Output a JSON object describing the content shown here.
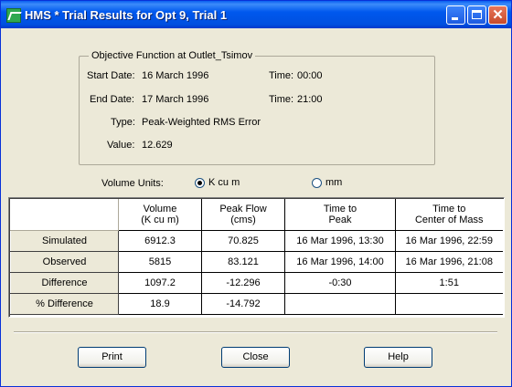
{
  "window": {
    "title": "HMS * Trial Results for Opt 9, Trial 1"
  },
  "objective": {
    "group_title": "Objective Function at Outlet_Tsimov",
    "start_date_label": "Start Date:",
    "start_date": "16 March 1996",
    "start_time_label": "Time:",
    "start_time": "00:00",
    "end_date_label": "End Date:",
    "end_date": "17 March 1996",
    "end_time_label": "Time:",
    "end_time": "21:00",
    "type_label": "Type:",
    "type": "Peak-Weighted RMS Error",
    "value_label": "Value:",
    "value": "12.629"
  },
  "volume_units": {
    "label": "Volume Units:",
    "options": [
      "K cu m",
      "mm"
    ],
    "selected": "K cu m"
  },
  "table": {
    "headers": [
      [
        "Volume",
        "(K cu m)"
      ],
      [
        "Peak Flow",
        "(cms)"
      ],
      [
        "Time to",
        "Peak"
      ],
      [
        "Time to",
        "Center of Mass"
      ]
    ],
    "rows": [
      {
        "label": "Simulated",
        "cells": [
          "6912.3",
          "70.825",
          "16 Mar 1996, 13:30",
          "16 Mar 1996, 22:59"
        ]
      },
      {
        "label": "Observed",
        "cells": [
          "5815",
          "83.121",
          "16 Mar 1996, 14:00",
          "16 Mar 1996, 21:08"
        ]
      },
      {
        "label": "Difference",
        "cells": [
          "1097.2",
          "-12.296",
          "-0:30",
          "1:51"
        ]
      },
      {
        "label": "% Difference",
        "cells": [
          "18.9",
          "-14.792",
          "",
          ""
        ]
      }
    ]
  },
  "buttons": {
    "print": "Print",
    "close": "Close",
    "help": "Help"
  }
}
